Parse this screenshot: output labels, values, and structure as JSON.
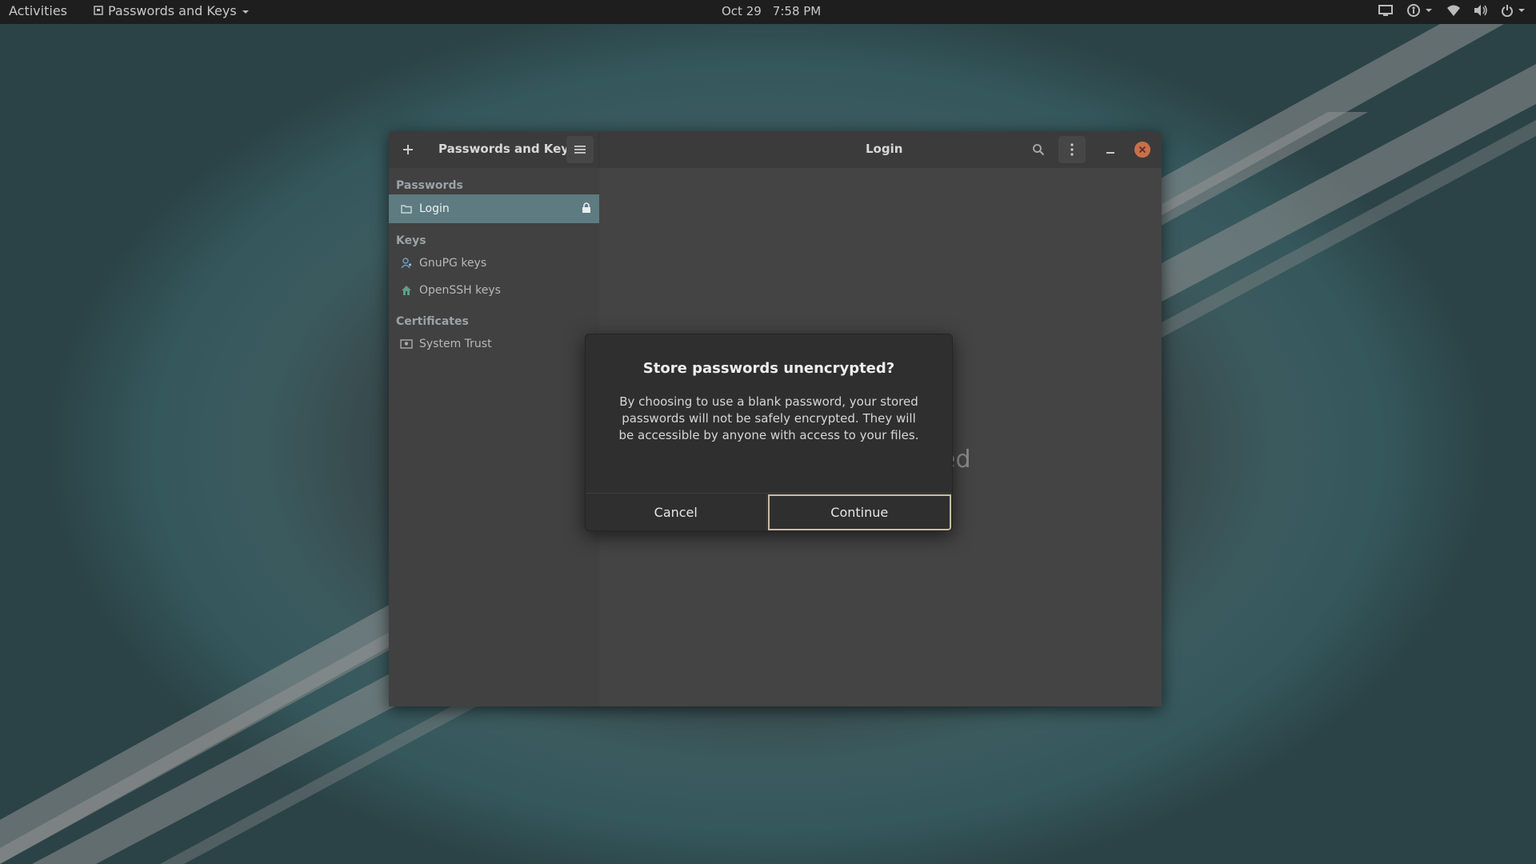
{
  "topbar": {
    "activities": "Activities",
    "app_menu_label": "Passwords and Keys",
    "date": "Oct 29",
    "time": "7:58 PM"
  },
  "window": {
    "sidebar_title": "Passwords and Keys",
    "content_title": "Login",
    "placeholder_fragment": "ed",
    "sidebar": {
      "sections": [
        {
          "label": "Passwords",
          "items": [
            {
              "label": "Login",
              "icon": "folder-icon",
              "selected": true,
              "locked": true
            }
          ]
        },
        {
          "label": "Keys",
          "items": [
            {
              "label": "GnuPG keys",
              "icon": "person-key-icon"
            },
            {
              "label": "OpenSSH keys",
              "icon": "house-key-icon"
            }
          ]
        },
        {
          "label": "Certificates",
          "items": [
            {
              "label": "System Trust",
              "icon": "certificate-icon"
            }
          ]
        }
      ]
    }
  },
  "dialog": {
    "title": "Store passwords unencrypted?",
    "body_line1": "By choosing to use a blank password, your stored",
    "body_line2": "passwords will not be safely encrypted. They will",
    "body_line3": "be accessible by anyone with access to your files.",
    "cancel_label": "Cancel",
    "continue_label": "Continue"
  },
  "colors": {
    "selection": "#5d7b80",
    "close_button": "#c8704a",
    "continue_border": "#c9bca3"
  }
}
